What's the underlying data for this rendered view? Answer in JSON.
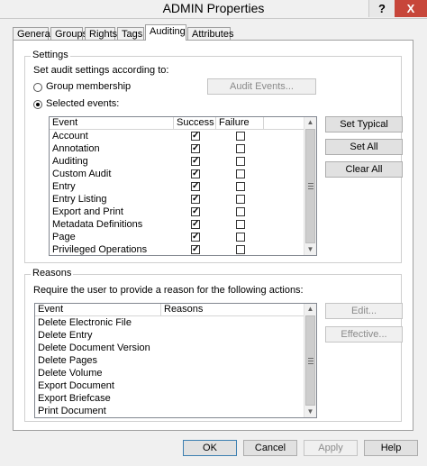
{
  "window": {
    "title": "ADMIN Properties",
    "help_glyph": "?",
    "close_glyph": "X"
  },
  "tabs": [
    "General",
    "Groups",
    "Rights",
    "Tags",
    "Auditing",
    "Attributes"
  ],
  "settings": {
    "group_title": "Settings",
    "instruction": "Set audit settings according to:",
    "radio_group": "Group membership",
    "radio_selected": "Selected events:",
    "audit_events_button": "Audit Events...",
    "col_event": "Event",
    "col_success": "Success",
    "col_failure": "Failure",
    "events": [
      {
        "name": "Account",
        "success": true,
        "failure": false
      },
      {
        "name": "Annotation",
        "success": true,
        "failure": false
      },
      {
        "name": "Auditing",
        "success": true,
        "failure": false
      },
      {
        "name": "Custom Audit",
        "success": true,
        "failure": false
      },
      {
        "name": "Entry",
        "success": true,
        "failure": false
      },
      {
        "name": "Entry Listing",
        "success": true,
        "failure": false
      },
      {
        "name": "Export and Print",
        "success": true,
        "failure": false
      },
      {
        "name": "Metadata Definitions",
        "success": true,
        "failure": false
      },
      {
        "name": "Page",
        "success": true,
        "failure": false
      },
      {
        "name": "Privileged Operations",
        "success": true,
        "failure": false
      }
    ],
    "set_typical": "Set Typical",
    "set_all": "Set All",
    "clear_all": "Clear All"
  },
  "reasons": {
    "group_title": "Reasons",
    "instruction": "Require the user to provide a reason for the following actions:",
    "col_event": "Event",
    "col_reasons": "Reasons",
    "rows": [
      "Delete Electronic File",
      "Delete Entry",
      "Delete Document Version",
      "Delete Pages",
      "Delete Volume",
      "Export Document",
      "Export Briefcase",
      "Print Document"
    ],
    "edit_button": "Edit...",
    "effective_button": "Effective..."
  },
  "footer": {
    "ok": "OK",
    "cancel": "Cancel",
    "apply": "Apply",
    "help": "Help"
  }
}
